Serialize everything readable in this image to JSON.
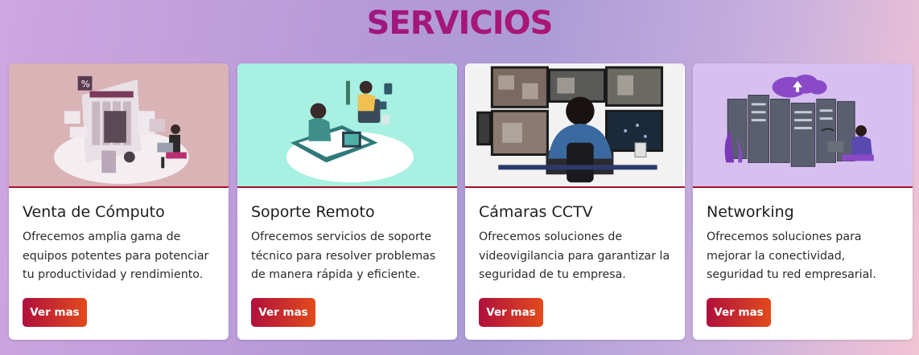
{
  "heading": "SERVICIOS",
  "cards": [
    {
      "title": "Venta de Cómputo",
      "text": "Ofrecemos amplia gama de equipos potentes para potenciar tu productividad y rendimiento.",
      "button": "Ver mas",
      "image": "computer-store-illustration",
      "bg": "#d9b3b6"
    },
    {
      "title": "Soporte Remoto",
      "text": "Ofrecemos servicios de soporte técnico para resolver problemas de manera rápida y eficiente.",
      "button": "Ver mas",
      "image": "remote-support-illustration",
      "bg": "#a8f0e2"
    },
    {
      "title": "Cámaras CCTV",
      "text": "Ofrecemos soluciones de videovigilancia para garantizar la seguridad de tu empresa.",
      "button": "Ver mas",
      "image": "cctv-monitoring-photo",
      "bg": "#ffffff"
    },
    {
      "title": "Networking",
      "text": "Ofrecemos soluciones para mejorar la conectividad, seguridad tu red empresarial.",
      "button": "Ver mas",
      "image": "networking-servers-illustration",
      "bg": "#d7bff0"
    }
  ],
  "colors": {
    "heading_from": "#8a1a9a",
    "heading_to": "#c0145a",
    "button_from": "#b0103c",
    "button_to": "#e24a1c",
    "divider": "#a8102a"
  }
}
